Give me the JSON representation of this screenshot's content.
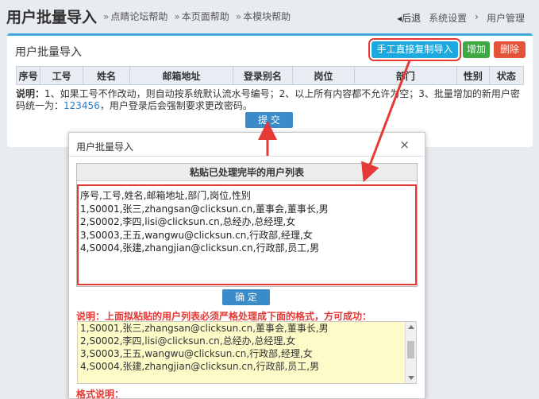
{
  "header": {
    "title": "用户批量导入",
    "help_links": [
      "点睛论坛帮助",
      "本页面帮助",
      "本模块帮助"
    ],
    "back_label": "后退",
    "breadcrumb": [
      "系统设置",
      "用户管理"
    ]
  },
  "panel": {
    "title": "用户批量导入",
    "copy_button": "手工直接复制导入",
    "add_button": "增加",
    "delete_button": "删除",
    "columns": [
      "序号",
      "工号",
      "姓名",
      "邮箱地址",
      "登录别名",
      "岗位",
      "部门",
      "性别",
      "状态"
    ],
    "explain_label": "说明：",
    "explain_text": "1、如果工号不作改动，则自动按系统默认流水号编号；2、以上所有内容都不允许为空；3、批量增加的新用户密码统一为：",
    "default_password": "123456",
    "explain_tail": "，用户登录后会强制要求更改密码。",
    "submit_button": "提 交"
  },
  "dialog": {
    "title": "用户批量导入",
    "close_icon": "×",
    "paste_header": "粘贴已处理完毕的用户列表",
    "paste_value": "序号,工号,姓名,邮箱地址,部门,岗位,性别\n1,S0001,张三,zhangsan@clicksun.cn,董事会,董事长,男\n2,S0002,李四,lisi@clicksun.cn,总经办,总经理,女\n3,S0003,王五,wangwu@clicksun.cn,行政部,经理,女\n4,S0004,张建,zhangjian@clicksun.cn,行政部,员工,男",
    "confirm_button": "确 定",
    "note_label": "说明：",
    "note_text": "上面拟粘贴的用户列表必须严格处理成下面的格式，方可成功：",
    "example_text": "1,S0001,张三,zhangsan@clicksun.cn,董事会,董事长,男\n2,S0002,李四,lisi@clicksun.cn,总经办,总经理,女\n3,S0003,王五,wangwu@clicksun.cn,行政部,经理,女\n4,S0004,张建,zhangjian@clicksun.cn,行政部,员工,男",
    "format_label": "格式说明："
  },
  "colors": {
    "accent": "#3fa7dc",
    "highlight": "#e53935",
    "add": "#3ea843",
    "delete": "#e2533a"
  }
}
